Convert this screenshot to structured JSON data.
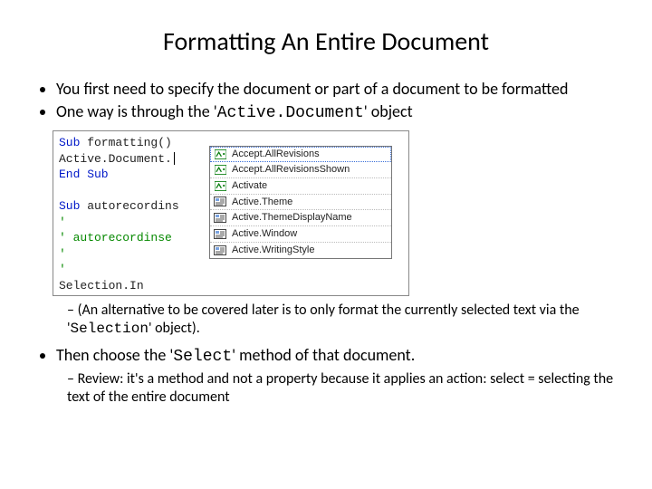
{
  "title": "Formatting An Entire Document",
  "bullets": {
    "b1": "You first need to specify the document or part of a document to be formatted",
    "b2_pre": "One way is through the '",
    "b2_code": "Active.Document",
    "b2_post": "' object",
    "sub1_pre": "(An alternative to be covered later is to only format the currently selected text via the '",
    "sub1_code": "Selection",
    "sub1_post": "' object).",
    "b3_pre": "Then choose the '",
    "b3_code": "Select",
    "b3_post": "' method of that document.",
    "sub2": "Review: it's a method and not a property because it applies an action: select = selecting the text of the entire document"
  },
  "code": {
    "l1_kw": "Sub",
    "l1_rest": " formatting()",
    "l2": "    Active.Document.",
    "l3_kw": "End Sub",
    "l5_kw": "Sub",
    "l5_rest": " autorecordins",
    "l6": "'",
    "l7": "' autorecordinse",
    "l8": "'",
    "l9": "'",
    "l10": "    Selection.In"
  },
  "intellisense": {
    "items": [
      {
        "kind": "method",
        "label": "Accept.AllRevisions"
      },
      {
        "kind": "method",
        "label": "Accept.AllRevisionsShown"
      },
      {
        "kind": "method",
        "label": "Activate"
      },
      {
        "kind": "prop",
        "label": "Active.Theme"
      },
      {
        "kind": "prop",
        "label": "Active.ThemeDisplayName"
      },
      {
        "kind": "prop",
        "label": "Active.Window"
      },
      {
        "kind": "prop",
        "label": "Active.WritingStyle"
      }
    ]
  }
}
